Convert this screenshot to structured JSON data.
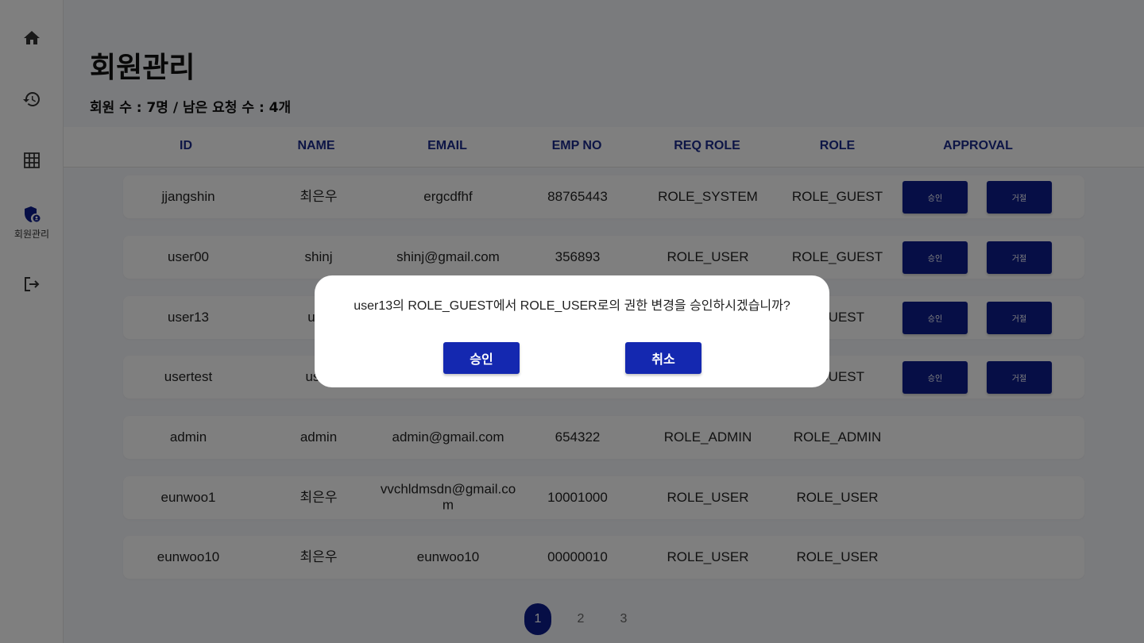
{
  "sidebar": {
    "items": [
      {
        "icon": "home-icon",
        "label": ""
      },
      {
        "icon": "history-icon",
        "label": ""
      },
      {
        "icon": "grid-icon",
        "label": ""
      },
      {
        "icon": "user-shield-icon",
        "label": "회원관리"
      },
      {
        "icon": "logout-icon",
        "label": ""
      }
    ]
  },
  "page": {
    "title": "회원관리",
    "summary": "회원 수 : 7명 / 남은 요청 수 : 4개"
  },
  "table": {
    "headers": [
      "ID",
      "NAME",
      "EMAIL",
      "EMP NO",
      "REQ ROLE",
      "ROLE",
      "APPROVAL"
    ],
    "approve_label": "승인",
    "reject_label": "거절",
    "rows": [
      {
        "id": "jjangshin",
        "name": "최은우",
        "email": "ergcdfhf",
        "emp_no": "88765443",
        "req_role": "ROLE_SYSTEM",
        "role": "ROLE_GUEST",
        "pending": true
      },
      {
        "id": "user00",
        "name": "shinj",
        "email": "shinj@gmail.com",
        "emp_no": "356893",
        "req_role": "ROLE_USER",
        "role": "ROLE_GUEST",
        "pending": true
      },
      {
        "id": "user13",
        "name": "use",
        "email": "",
        "emp_no": "",
        "req_role": "",
        "role": "_GUEST",
        "pending": true
      },
      {
        "id": "usertest",
        "name": "user",
        "email": "",
        "emp_no": "",
        "req_role": "",
        "role": "_GUEST",
        "pending": true
      },
      {
        "id": "admin",
        "name": "admin",
        "email": "admin@gmail.com",
        "emp_no": "654322",
        "req_role": "ROLE_ADMIN",
        "role": "ROLE_ADMIN",
        "pending": false
      },
      {
        "id": "eunwoo1",
        "name": "최은우",
        "email": "vvchldmsdn@gmail.com",
        "emp_no": "10001000",
        "req_role": "ROLE_USER",
        "role": "ROLE_USER",
        "pending": false
      },
      {
        "id": "eunwoo10",
        "name": "최은우",
        "email": "eunwoo10",
        "emp_no": "00000010",
        "req_role": "ROLE_USER",
        "role": "ROLE_USER",
        "pending": false
      }
    ]
  },
  "pagination": {
    "pages": [
      "1",
      "2",
      "3"
    ],
    "current": "1"
  },
  "dialog": {
    "message": "user13의 ROLE_GUEST에서 ROLE_USER로의 권한 변경을 승인하시겠습니까?",
    "confirm_label": "승인",
    "cancel_label": "취소"
  },
  "colors": {
    "accent": "#0d1c8c",
    "header_text": "#1a2a8c",
    "dialog_button": "#1428b0",
    "overlay": "rgba(0,0,0,0.5)"
  }
}
